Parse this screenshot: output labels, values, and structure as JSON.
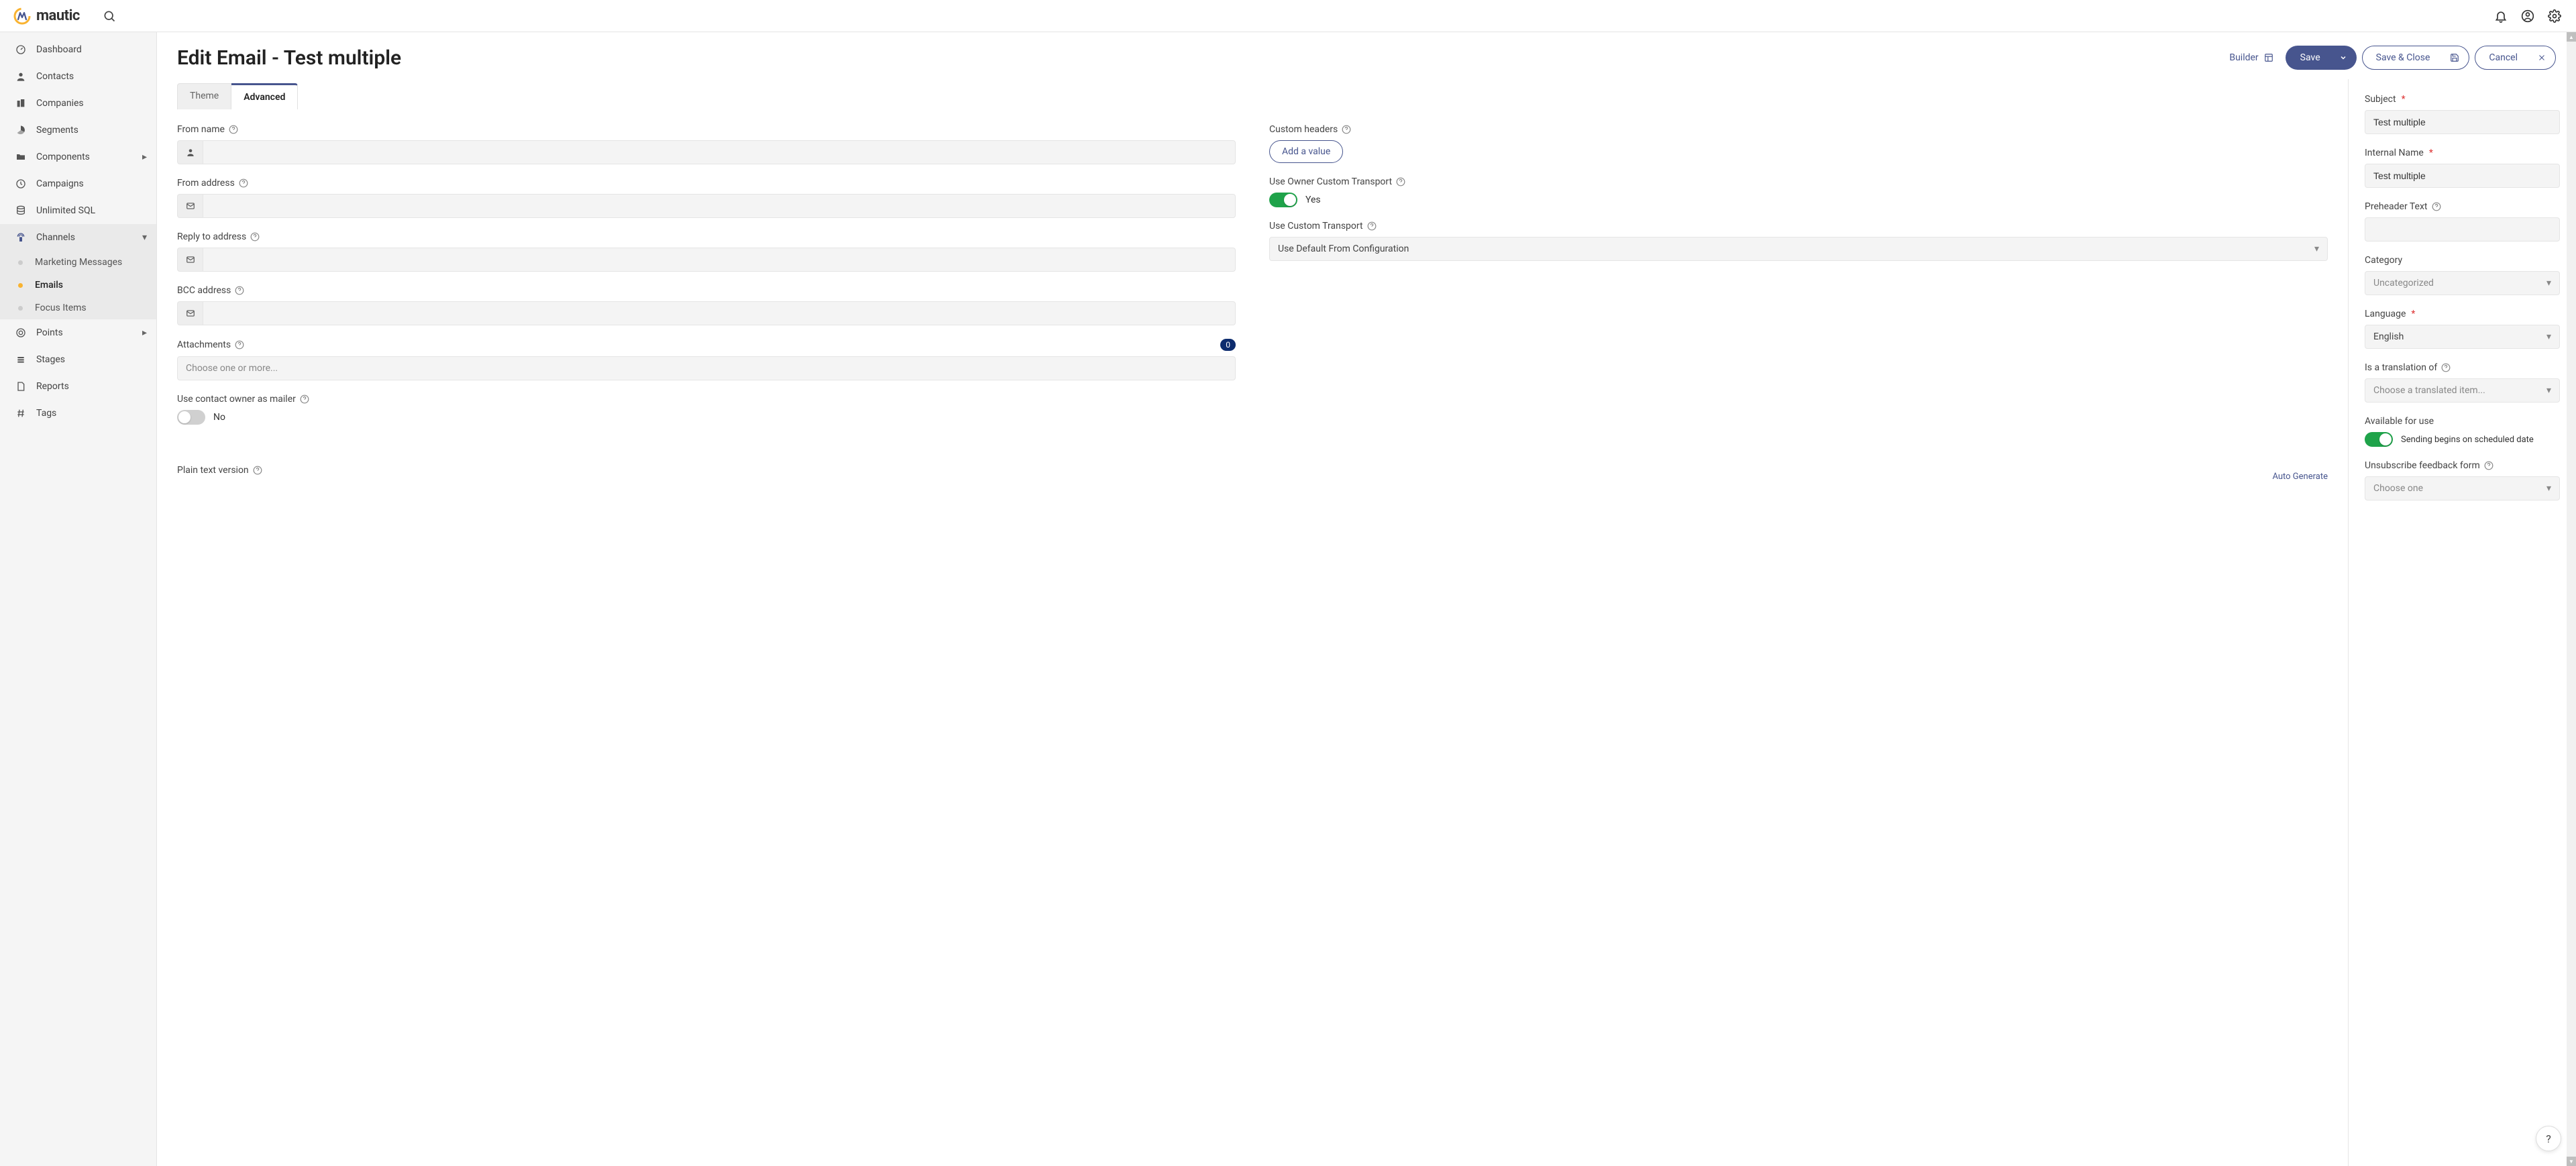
{
  "brand": "mautic",
  "topbar": {
    "search": "Search"
  },
  "sidebar": {
    "items": [
      {
        "label": "Dashboard"
      },
      {
        "label": "Contacts"
      },
      {
        "label": "Companies"
      },
      {
        "label": "Segments"
      },
      {
        "label": "Components"
      },
      {
        "label": "Campaigns"
      },
      {
        "label": "Unlimited SQL"
      },
      {
        "label": "Channels"
      },
      {
        "label": "Points"
      },
      {
        "label": "Stages"
      },
      {
        "label": "Reports"
      },
      {
        "label": "Tags"
      }
    ],
    "channels_children": [
      {
        "label": "Marketing Messages"
      },
      {
        "label": "Emails"
      },
      {
        "label": "Focus Items"
      }
    ]
  },
  "header": {
    "title": "Edit Email - Test multiple",
    "builder": "Builder",
    "save": "Save",
    "save_close": "Save & Close",
    "cancel": "Cancel"
  },
  "tabs": {
    "theme": "Theme",
    "advanced": "Advanced"
  },
  "form": {
    "from_name": "From name",
    "from_address": "From address",
    "reply_to": "Reply to address",
    "bcc": "BCC address",
    "attachments": "Attachments",
    "attachments_count": "0",
    "attachments_placeholder": "Choose one or more...",
    "use_contact_owner": "Use contact owner as mailer",
    "use_contact_owner_state": "No",
    "custom_headers": "Custom headers",
    "custom_headers_add": "Add a value",
    "use_owner_transport": "Use Owner Custom Transport",
    "use_owner_transport_state": "Yes",
    "use_custom_transport": "Use Custom Transport",
    "use_custom_transport_value": "Use Default From Configuration",
    "plain_text": "Plain text version",
    "auto_generate": "Auto Generate"
  },
  "side": {
    "subject": "Subject",
    "subject_value": "Test multiple",
    "internal_name": "Internal Name",
    "internal_name_value": "Test multiple",
    "preheader": "Preheader Text",
    "category": "Category",
    "category_value": "Uncategorized",
    "language": "Language",
    "language_value": "English",
    "translation_of": "Is a translation of",
    "translation_value": "Choose a translated item...",
    "available": "Available for use",
    "available_text": "Sending begins on scheduled date",
    "unsubscribe": "Unsubscribe feedback form",
    "unsubscribe_value": "Choose one"
  },
  "help_fab": "?"
}
